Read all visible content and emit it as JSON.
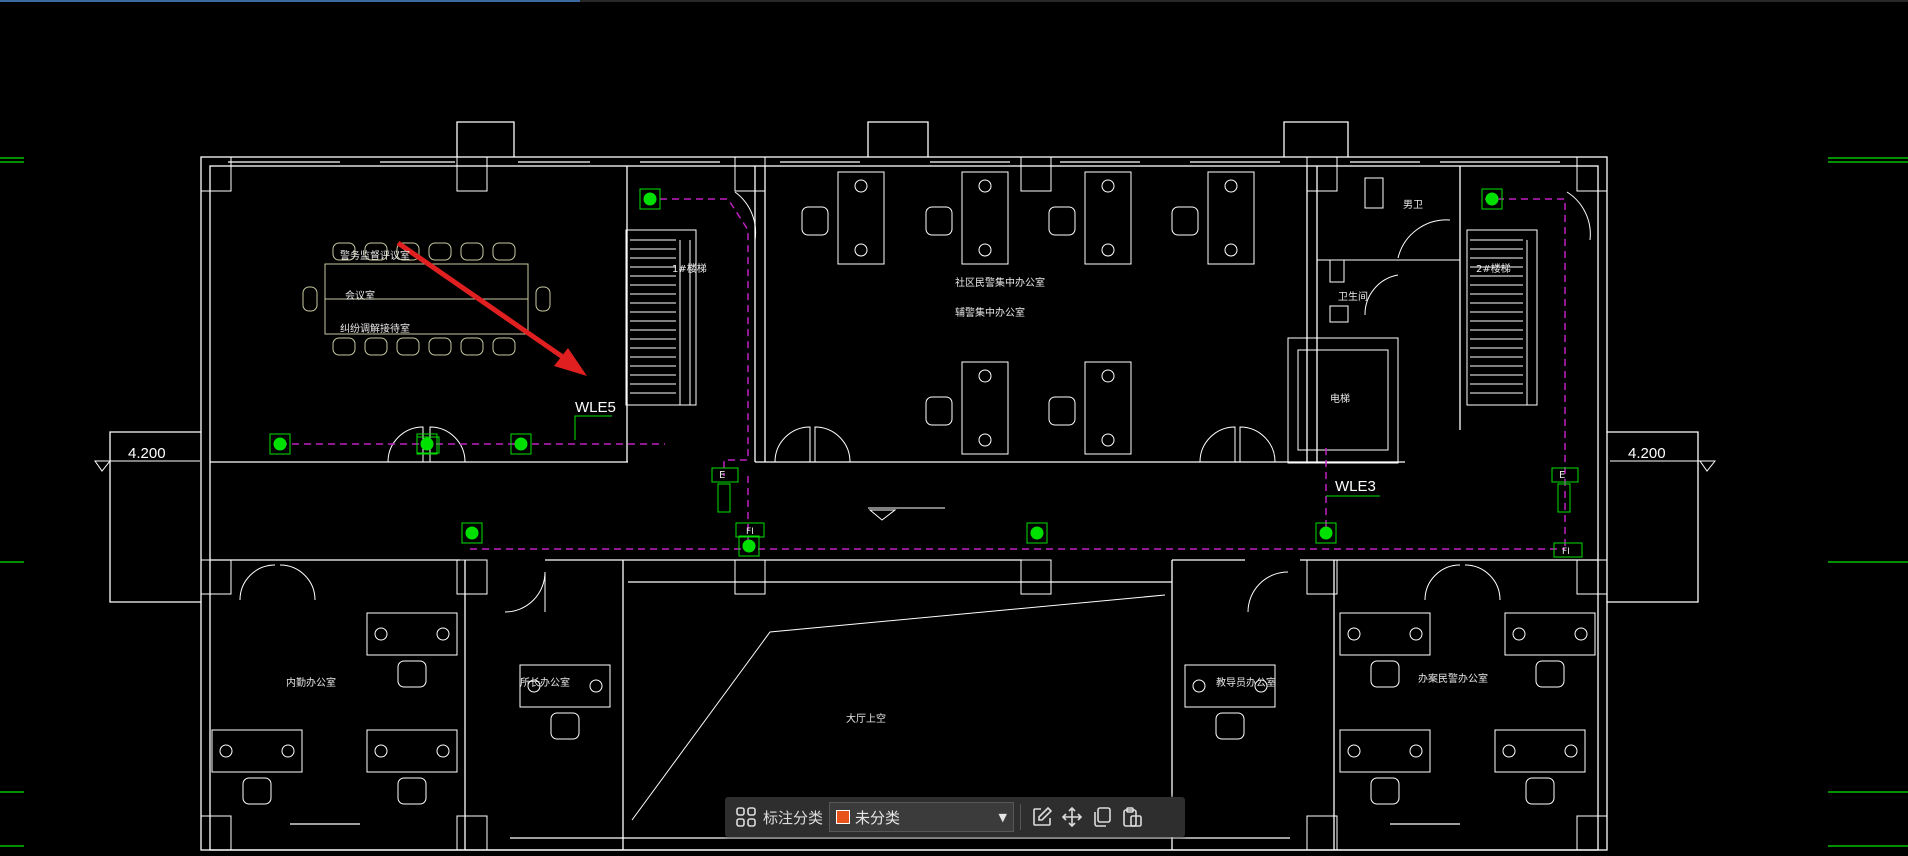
{
  "drawing": {
    "rooms": {
      "meeting_1": "警务监督评议室",
      "meeting_2": "会议室",
      "meeting_3": "纠纷调解接待室",
      "stair_1": "1#楼梯",
      "stair_2": "2#楼梯",
      "office_a": "社区民警集中办公室",
      "office_b": "辅警集中办公室",
      "toilet_m": "男卫",
      "toilet_f": "卫生间",
      "elevator": "电梯",
      "internal_office": "内勤办公室",
      "director_office": "所长办公室",
      "hall_upper": "大厅上空",
      "instructor_office": "教导员办公室",
      "case_office": "办案民警办公室"
    },
    "level_left": "4.200",
    "level_right": "4.200",
    "circuit_labels": {
      "wle5": "WLE5",
      "wle3": "WLE3"
    },
    "fixture_labels": {
      "exit": "E",
      "floor": "FI"
    }
  },
  "toolbar": {
    "grid_icon": "grid-icon",
    "label": "标注分类",
    "category_value": "未分类",
    "category_color": "#e8531a",
    "actions": [
      "edit-icon",
      "move-icon",
      "copy-icon",
      "paste-icon"
    ]
  },
  "colors": {
    "wall": "#ffffff",
    "circuit": "#c020c0",
    "fixture": "#00e000",
    "annotation_arrow": "#e02020",
    "axis_mark": "#00c000"
  }
}
